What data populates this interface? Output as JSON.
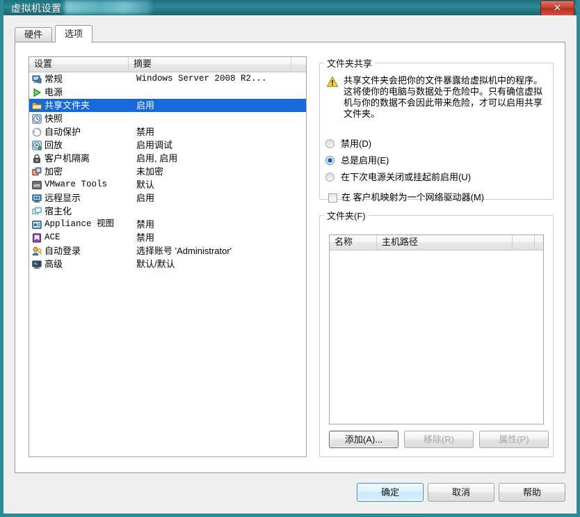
{
  "window": {
    "title": "虚拟机设置",
    "title_redacted": true,
    "close_label": "✕"
  },
  "tabs": [
    {
      "label": "硬件",
      "active": false
    },
    {
      "label": "选项",
      "active": true
    }
  ],
  "settings_list": {
    "headers": [
      "设置",
      "摘要"
    ],
    "rows": [
      {
        "icon": "computer-icon",
        "name": "常规",
        "summary": "Windows Server 2008 R2...",
        "selected": false,
        "mono_summary": true
      },
      {
        "icon": "power-play-icon",
        "name": "电源",
        "summary": "",
        "selected": false
      },
      {
        "icon": "folder-icon",
        "name": "共享文件夹",
        "summary": "启用",
        "selected": true
      },
      {
        "icon": "snapshot-clock-icon",
        "name": "快照",
        "summary": "",
        "selected": false
      },
      {
        "icon": "autoprotect-icon",
        "name": "自动保护",
        "summary": "禁用",
        "selected": false
      },
      {
        "icon": "replay-icon",
        "name": "回放",
        "summary": "启用调试",
        "selected": false
      },
      {
        "icon": "lock-icon",
        "name": "客户机隔离",
        "summary": "启用, 启用",
        "selected": false
      },
      {
        "icon": "encryption-icon",
        "name": "加密",
        "summary": "未加密",
        "selected": false
      },
      {
        "icon": "vmware-tools-icon",
        "name": "VMware Tools",
        "summary": "默认",
        "selected": false,
        "mono_name": true
      },
      {
        "icon": "remote-display-icon",
        "name": "远程显示",
        "summary": "启用",
        "selected": false
      },
      {
        "icon": "unity-icon",
        "name": "宿主化",
        "summary": "",
        "selected": false
      },
      {
        "icon": "appliance-view-icon",
        "name": "Appliance 视图",
        "summary": "禁用",
        "selected": false,
        "mono_name": true
      },
      {
        "icon": "ace-icon",
        "name": "ACE",
        "summary": "禁用",
        "selected": false,
        "mono_name": true
      },
      {
        "icon": "autologon-key-icon",
        "name": "自动登录",
        "summary": "选择账号 'Administrator'",
        "selected": false
      },
      {
        "icon": "advanced-icon",
        "name": "高级",
        "summary": "默认/默认",
        "selected": false
      }
    ]
  },
  "folder_sharing": {
    "legend": "文件夹共享",
    "warning_icon": "warning-icon",
    "warning_text": "共享文件夹会把你的文件暴露给虚拟机中的程序。这将使你的电脑与数据处于危险中。只有确信虚拟机与你的数据不会因此带来危险，才可以启用共享文件夹。",
    "options": [
      {
        "label": "禁用(D)",
        "selected": false
      },
      {
        "label": "总是启用(E)",
        "selected": true
      },
      {
        "label": "在下次电源关闭或挂起前启用(U)",
        "selected": false
      }
    ],
    "map_drive": {
      "label": "在  客户机映射为一个网络驱动器(M)",
      "checked": false
    }
  },
  "folders": {
    "legend": "文件夹(F)",
    "headers": [
      "名称",
      "主机路径"
    ],
    "rows": [],
    "buttons": [
      {
        "label": "添加(A)...",
        "enabled": true,
        "focused": true
      },
      {
        "label": "移除(R)",
        "enabled": false,
        "focused": false
      },
      {
        "label": "属性(P)",
        "enabled": false,
        "focused": false
      }
    ]
  },
  "footer_buttons": [
    {
      "label": "确定",
      "default": true
    },
    {
      "label": "取消",
      "default": false
    },
    {
      "label": "帮助",
      "default": false
    }
  ]
}
